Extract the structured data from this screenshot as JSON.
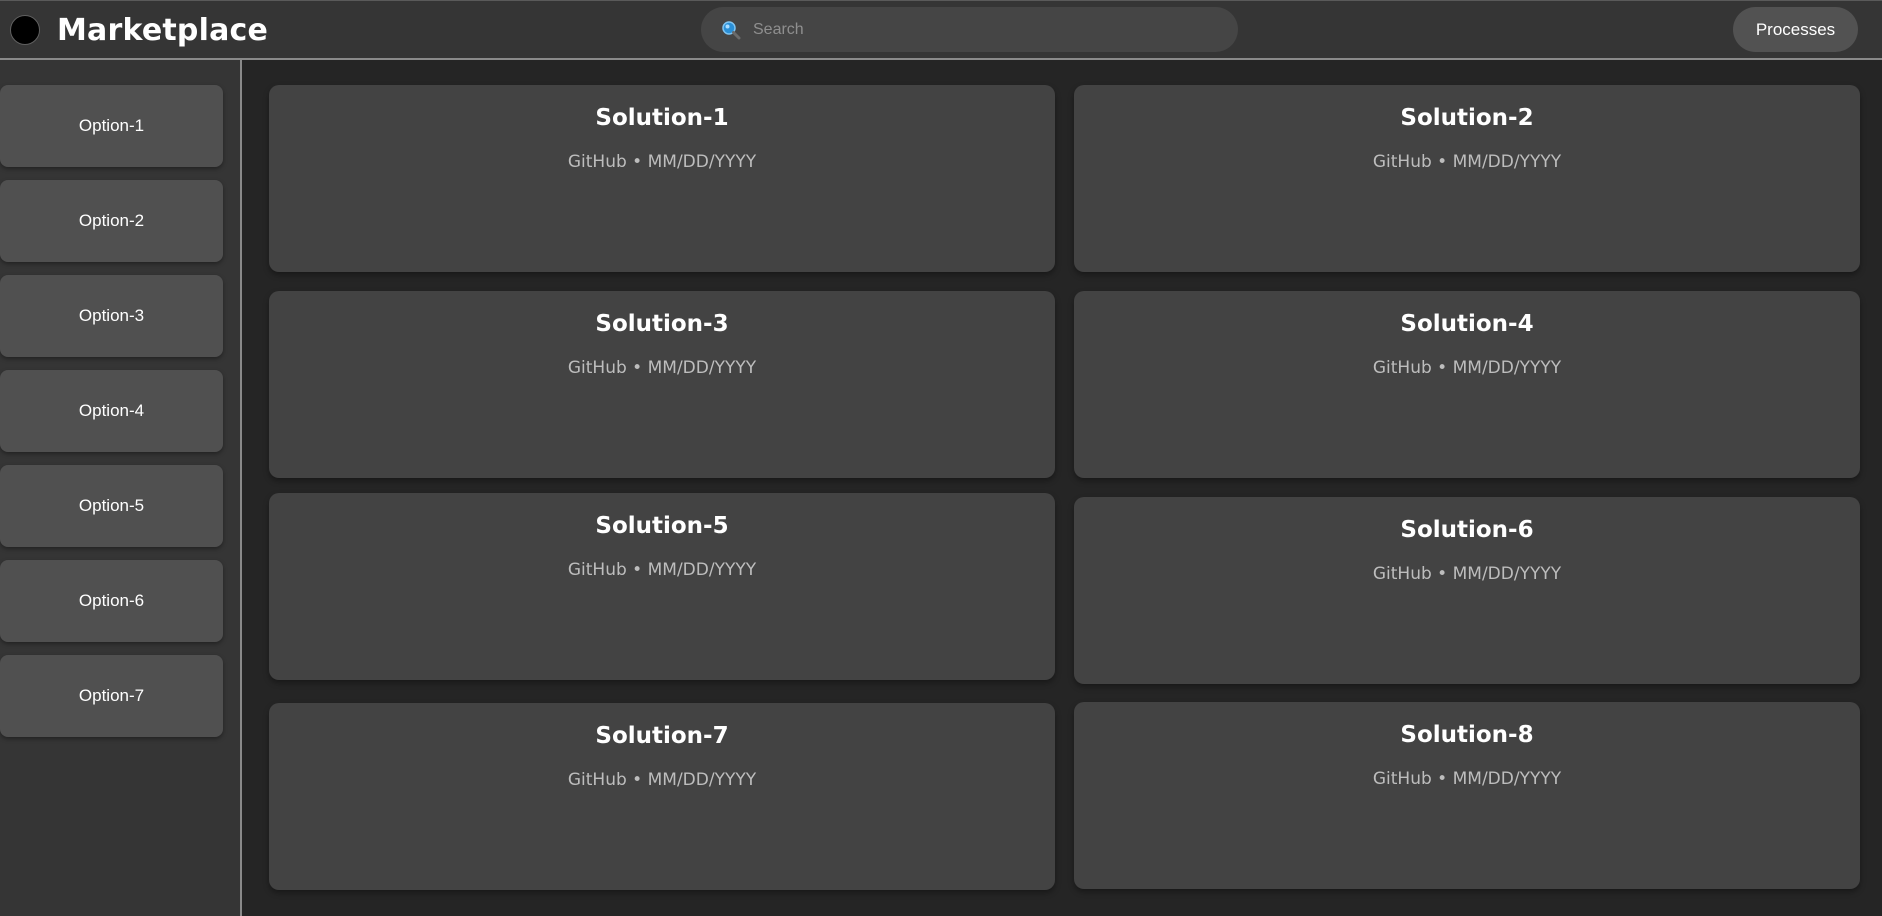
{
  "header": {
    "title": "Marketplace",
    "search_placeholder": "Search",
    "processes_label": "Processes"
  },
  "sidebar": {
    "items": [
      {
        "label": "Option-1"
      },
      {
        "label": "Option-2"
      },
      {
        "label": "Option-3"
      },
      {
        "label": "Option-4"
      },
      {
        "label": "Option-5"
      },
      {
        "label": "Option-6"
      },
      {
        "label": "Option-7"
      }
    ]
  },
  "cards": [
    {
      "title": "Solution-1",
      "meta": "GitHub • MM/DD/YYYY"
    },
    {
      "title": "Solution-2",
      "meta": "GitHub • MM/DD/YYYY"
    },
    {
      "title": "Solution-3",
      "meta": "GitHub • MM/DD/YYYY"
    },
    {
      "title": "Solution-4",
      "meta": "GitHub • MM/DD/YYYY"
    },
    {
      "title": "Solution-5",
      "meta": "GitHub • MM/DD/YYYY"
    },
    {
      "title": "Solution-6",
      "meta": "GitHub • MM/DD/YYYY"
    },
    {
      "title": "Solution-7",
      "meta": "GitHub • MM/DD/YYYY"
    },
    {
      "title": "Solution-8",
      "meta": "GitHub • MM/DD/YYYY"
    }
  ],
  "icons": {
    "logo": "circle-logo-icon",
    "search": "search-icon"
  },
  "colors": {
    "background": "#252525",
    "header": "#353535",
    "card": "#434343",
    "sidebar_item": "#505050",
    "search_icon_accent": "#2a8fd6"
  }
}
